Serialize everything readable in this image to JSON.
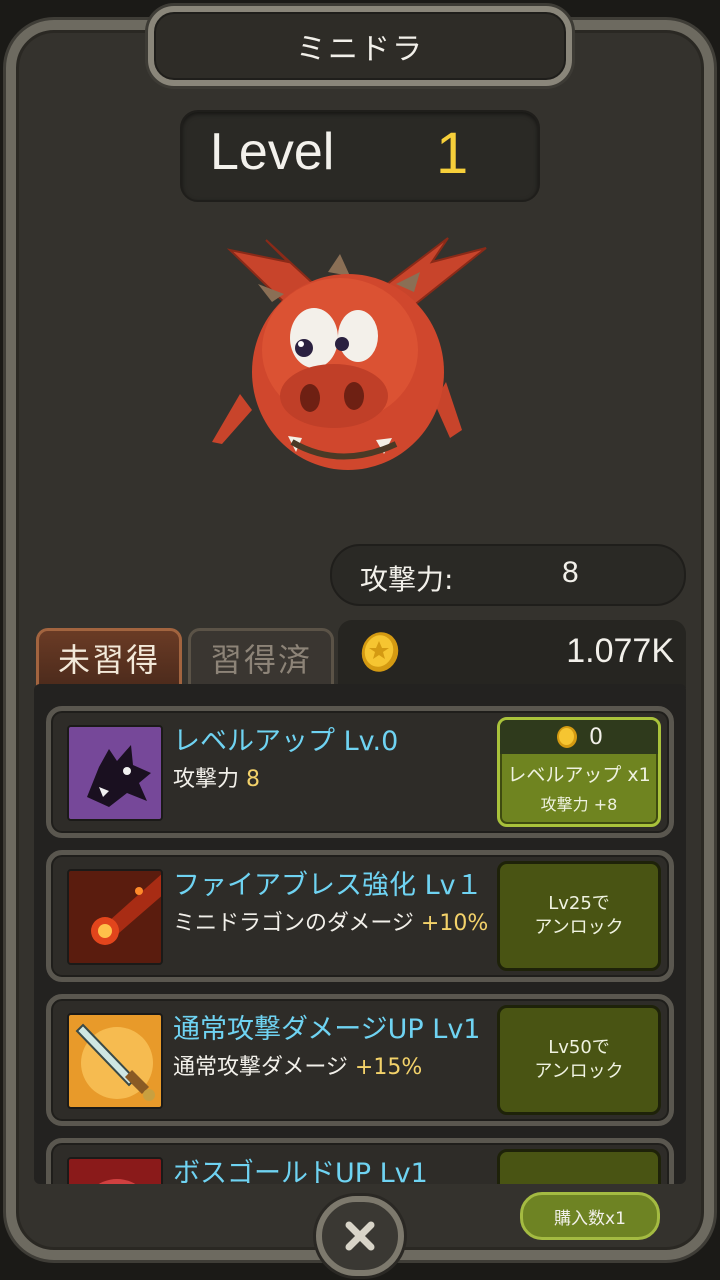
{
  "header": {
    "title": "ミニドラ"
  },
  "level": {
    "label": "Level",
    "value": "1"
  },
  "stats": {
    "attack_label": "攻撃力:",
    "attack_value": "8"
  },
  "tabs": [
    {
      "label": "未習得",
      "active": true
    },
    {
      "label": "習得済",
      "active": false
    }
  ],
  "gold": {
    "icon": "gold-coin-icon",
    "amount": "1.077K"
  },
  "skills": [
    {
      "icon": "dark-wolf-icon",
      "name": "レベルアップ Lv.0",
      "desc_text": "攻撃力 ",
      "desc_value": "8",
      "button": {
        "cost": "0",
        "label": "レベルアップ x1",
        "effect": "攻撃力 +8"
      }
    },
    {
      "icon": "fire-breath-icon",
      "name": "ファイアブレス強化 Lv１",
      "desc_text": "ミニドラゴンのダメージ ",
      "desc_value": "+10%",
      "button": {
        "lock_line1": "Lv25で",
        "lock_line2": "アンロック"
      }
    },
    {
      "icon": "sword-slash-icon",
      "name": "通常攻撃ダメージUP Lv1",
      "desc_text": "通常攻撃ダメージ ",
      "desc_value": "+15%",
      "button": {
        "lock_line1": "Lv50で",
        "lock_line2": "アンロック"
      }
    },
    {
      "icon": "boss-gold-icon",
      "name": "ボスゴールドUP Lv1"
    }
  ],
  "footer": {
    "close_icon": "close-icon",
    "purchase_qty_label": "購入数x1"
  },
  "colors": {
    "accent_gold": "#f6cf3a",
    "skill_name": "#6fd3f2",
    "highlight_value": "#f3d26a",
    "button_green": "#495413"
  }
}
